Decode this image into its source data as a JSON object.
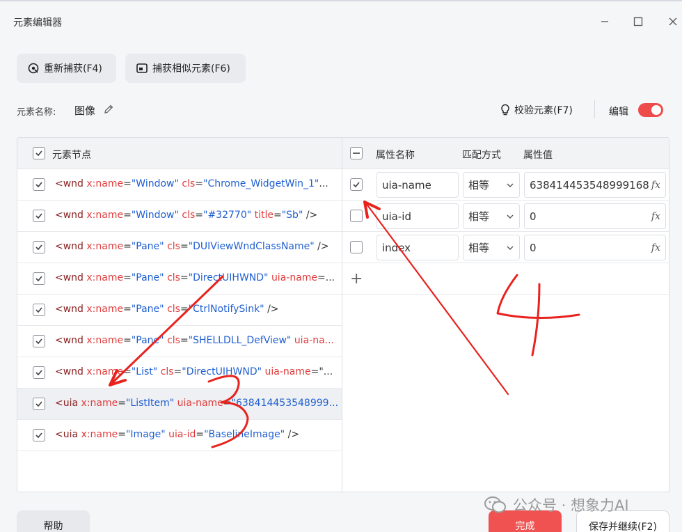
{
  "window": {
    "title": "元素编辑器"
  },
  "toolbar": {
    "recapture_label": "重新捕获(F4)",
    "capture_similar_label": "捕获相似元素(F6)"
  },
  "element": {
    "name_label": "元素名称:",
    "name_value": "图像",
    "verify_label": "校验元素(F7)",
    "edit_label": "编辑"
  },
  "nodes": {
    "header": "元素节点",
    "rows": [
      {
        "parts": [
          [
            "t-tag",
            "<wnd "
          ],
          [
            "t-attr",
            "x:name"
          ],
          [
            "t-eq",
            "="
          ],
          [
            "t-val",
            "\"Window\""
          ],
          [
            "t-eq",
            " "
          ],
          [
            "t-attr",
            "cls"
          ],
          [
            "t-eq",
            "="
          ],
          [
            "t-val",
            "\"Chrome_WidgetWin_1\""
          ],
          [
            "t-eq",
            "..."
          ]
        ]
      },
      {
        "parts": [
          [
            "t-tag",
            "<wnd "
          ],
          [
            "t-attr",
            "x:name"
          ],
          [
            "t-eq",
            "="
          ],
          [
            "t-val",
            "\"Window\""
          ],
          [
            "t-eq",
            " "
          ],
          [
            "t-attr",
            "cls"
          ],
          [
            "t-eq",
            "="
          ],
          [
            "t-val",
            "\"#32770\""
          ],
          [
            "t-eq",
            " "
          ],
          [
            "t-attr",
            "title"
          ],
          [
            "t-eq",
            "="
          ],
          [
            "t-val",
            "\"Sb\""
          ],
          [
            "t-eq",
            " />"
          ]
        ]
      },
      {
        "parts": [
          [
            "t-tag",
            "<wnd "
          ],
          [
            "t-attr",
            "x:name"
          ],
          [
            "t-eq",
            "="
          ],
          [
            "t-val",
            "\"Pane\""
          ],
          [
            "t-eq",
            " "
          ],
          [
            "t-attr",
            "cls"
          ],
          [
            "t-eq",
            "="
          ],
          [
            "t-val",
            "\"DUIViewWndClassName\""
          ],
          [
            "t-eq",
            " />"
          ]
        ]
      },
      {
        "parts": [
          [
            "t-tag",
            "<wnd "
          ],
          [
            "t-attr",
            "x:name"
          ],
          [
            "t-eq",
            "="
          ],
          [
            "t-val",
            "\"Pane\""
          ],
          [
            "t-eq",
            " "
          ],
          [
            "t-attr",
            "cls"
          ],
          [
            "t-eq",
            "="
          ],
          [
            "t-val",
            "\"DirectUIHWND\""
          ],
          [
            "t-eq",
            " "
          ],
          [
            "t-attr",
            "uia-name"
          ],
          [
            "t-eq",
            "=..."
          ]
        ]
      },
      {
        "parts": [
          [
            "t-tag",
            "<wnd "
          ],
          [
            "t-attr",
            "x:name"
          ],
          [
            "t-eq",
            "="
          ],
          [
            "t-val",
            "\"Pane\""
          ],
          [
            "t-eq",
            " "
          ],
          [
            "t-attr",
            "cls"
          ],
          [
            "t-eq",
            "="
          ],
          [
            "t-val",
            "\"CtrlNotifySink\""
          ],
          [
            "t-eq",
            " />"
          ]
        ]
      },
      {
        "parts": [
          [
            "t-tag",
            "<wnd "
          ],
          [
            "t-attr",
            "x:name"
          ],
          [
            "t-eq",
            "="
          ],
          [
            "t-val",
            "\"Pane\""
          ],
          [
            "t-eq",
            " "
          ],
          [
            "t-attr",
            "cls"
          ],
          [
            "t-eq",
            "="
          ],
          [
            "t-val",
            "\"SHELLDLL_DefView\""
          ],
          [
            "t-eq",
            " "
          ],
          [
            "t-attr",
            "uia-na..."
          ]
        ]
      },
      {
        "parts": [
          [
            "t-tag",
            "<wnd "
          ],
          [
            "t-attr",
            "x:name"
          ],
          [
            "t-eq",
            "="
          ],
          [
            "t-val",
            "\"List\""
          ],
          [
            "t-eq",
            " "
          ],
          [
            "t-attr",
            "cls"
          ],
          [
            "t-eq",
            "="
          ],
          [
            "t-val",
            "\"DirectUIHWND\""
          ],
          [
            "t-eq",
            " "
          ],
          [
            "t-attr",
            "uia-name"
          ],
          [
            "t-eq",
            "=\"..."
          ]
        ]
      },
      {
        "parts": [
          [
            "t-tag",
            "<uia "
          ],
          [
            "t-attr",
            "x:name"
          ],
          [
            "t-eq",
            "="
          ],
          [
            "t-val",
            "\"ListItem\""
          ],
          [
            "t-eq",
            " "
          ],
          [
            "t-attr",
            "uia-name"
          ],
          [
            "t-eq",
            "="
          ],
          [
            "t-val",
            "\"638414453548999..."
          ]
        ]
      },
      {
        "parts": [
          [
            "t-tag",
            "<uia "
          ],
          [
            "t-attr",
            "x:name"
          ],
          [
            "t-eq",
            "="
          ],
          [
            "t-val",
            "\"Image\""
          ],
          [
            "t-eq",
            " "
          ],
          [
            "t-attr",
            "uia-id"
          ],
          [
            "t-eq",
            "="
          ],
          [
            "t-val",
            "\"BaselineImage\""
          ],
          [
            "t-eq",
            " />"
          ]
        ]
      }
    ]
  },
  "attributes": {
    "header_name": "属性名称",
    "header_match": "匹配方式",
    "header_value": "属性值",
    "rows": [
      {
        "name": "uia-name",
        "match": "相等",
        "value": "638414453548999168",
        "checked": true
      },
      {
        "name": "uia-id",
        "match": "相等",
        "value": "0",
        "checked": false
      },
      {
        "name": "index",
        "match": "相等",
        "value": "0",
        "checked": false
      }
    ],
    "add_symbol": "+"
  },
  "footer": {
    "help_label": "帮助",
    "done_label": "完成",
    "save_continue_label": "保存并继续(F2)"
  },
  "watermark": {
    "text": "公众号 · 想象力AI"
  },
  "annotations": {
    "color": "#e8231e"
  }
}
